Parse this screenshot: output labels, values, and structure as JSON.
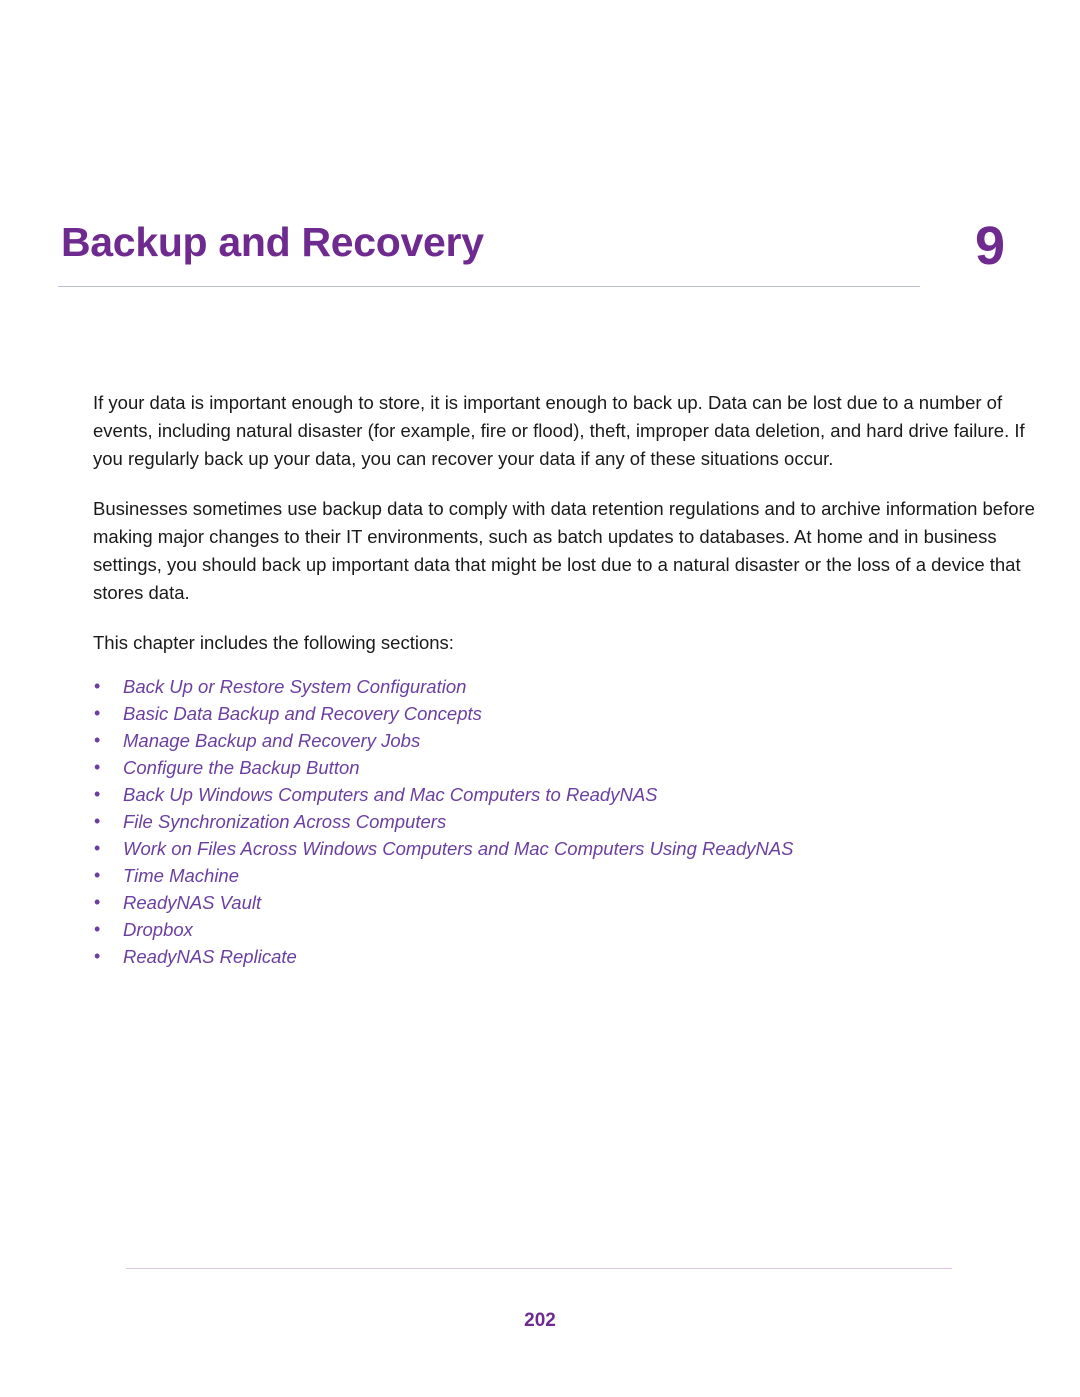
{
  "chapter": {
    "title": "Backup and Recovery",
    "number": "9"
  },
  "body": {
    "paragraphs": [
      "If your data is important enough to store, it is important enough to back up. Data can be lost due to a number of events, including natural disaster (for example, fire or flood), theft, improper data deletion, and hard drive failure. If you regularly back up your data, you can recover your data if any of these situations occur.",
      "Businesses sometimes use backup data to comply with data retention regulations and to archive information before making major changes to their IT environments, such as batch updates to databases. At home and in business settings, you should back up important data that might be lost due to a natural disaster or the loss of a device that stores data.",
      "This chapter includes the following sections:"
    ]
  },
  "sections": {
    "bullet_glyph": "•",
    "items": [
      "Back Up or Restore System Configuration",
      "Basic Data Backup and Recovery Concepts",
      "Manage Backup and Recovery Jobs",
      "Configure the Backup Button",
      "Back Up Windows Computers and Mac Computers to ReadyNAS",
      "File Synchronization Across Computers",
      "Work on Files Across Windows Computers and Mac Computers Using ReadyNAS",
      "Time Machine",
      "ReadyNAS Vault",
      "Dropbox",
      "ReadyNAS Replicate"
    ]
  },
  "footer": {
    "page_number": "202"
  },
  "colors": {
    "heading_purple": "#6e2a8e",
    "link_purple": "#6b3fa0",
    "title_rule": "#b9bcd4",
    "footer_rule": "#ddc4e2",
    "body_text": "#1a1a1a"
  }
}
